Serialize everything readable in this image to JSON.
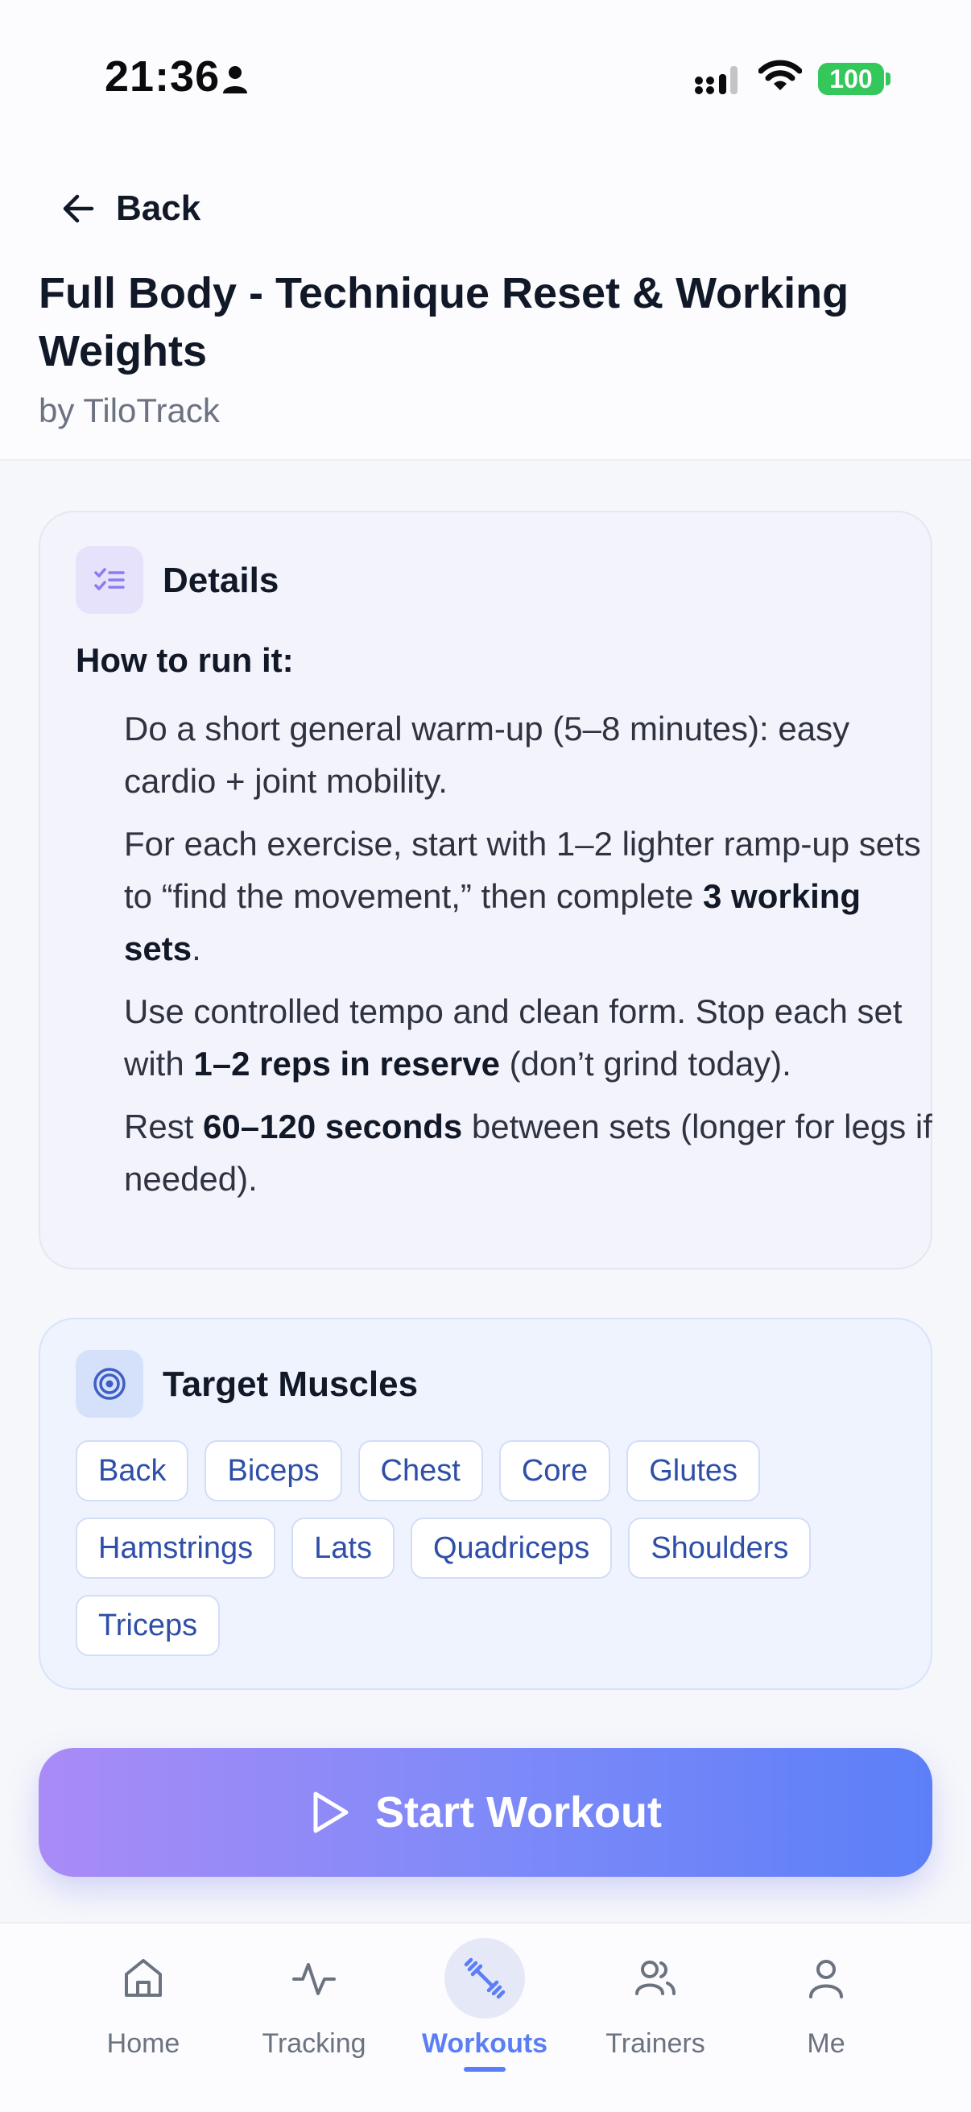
{
  "status_bar": {
    "time": "21:36",
    "battery": "100",
    "icons": [
      "person-icon",
      "signal-icon",
      "wifi-icon",
      "battery-icon"
    ],
    "battery_color": "#34c759"
  },
  "header": {
    "back_label": "Back",
    "title": "Full Body - Technique Reset & Working Weights",
    "author": "by TiloTrack"
  },
  "details": {
    "title": "Details",
    "icon": "checklist-icon",
    "how_heading": "How to run it:",
    "steps": [
      {
        "before": "Do a short general warm-up (5–8 minutes): easy cardio + joint mobility.",
        "bold": "",
        "after": ""
      },
      {
        "before": "For each exercise, start with 1–2 lighter ramp-up sets to “find the movement,” then complete ",
        "bold": "3 working sets",
        "after": "."
      },
      {
        "before": "Use controlled tempo and clean form. Stop each set with ",
        "bold": "1–2 reps in reserve",
        "after": " (don’t grind today)."
      },
      {
        "before": "Rest ",
        "bold": "60–120 seconds",
        "after": " between sets (longer for legs if needed)."
      }
    ]
  },
  "target_muscles": {
    "title": "Target Muscles",
    "icon": "target-icon",
    "muscles": [
      "Back",
      "Biceps",
      "Chest",
      "Core",
      "Glutes",
      "Hamstrings",
      "Lats",
      "Quadriceps",
      "Shoulders",
      "Triceps"
    ]
  },
  "start_button": {
    "label": "Start Workout",
    "icon": "play-icon"
  },
  "bottom_nav": {
    "items": [
      {
        "label": "Home",
        "icon": "home-icon"
      },
      {
        "label": "Tracking",
        "icon": "activity-icon"
      },
      {
        "label": "Workouts",
        "icon": "dumbbell-icon",
        "active": true
      },
      {
        "label": "Trainers",
        "icon": "users-icon"
      },
      {
        "label": "Me",
        "icon": "user-icon"
      }
    ]
  },
  "colors": {
    "accent": "#5b7ef6",
    "gradient_start": "#a98bf6",
    "gradient_end": "#5c7ff8",
    "chip_text": "#2f4ea8"
  }
}
